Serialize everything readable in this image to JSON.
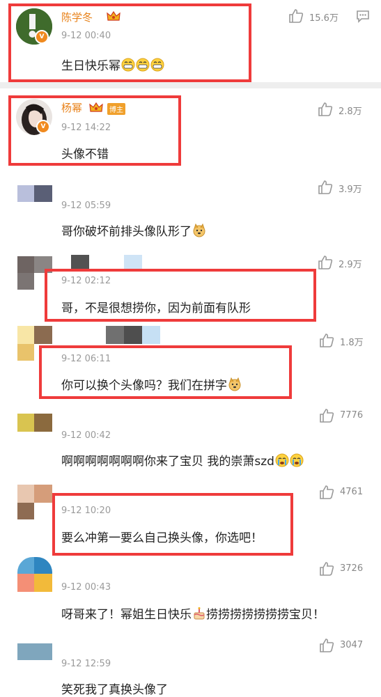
{
  "comments": [
    {
      "name": "陈学冬",
      "time": "9-12 00:40",
      "text": "生日快乐幂",
      "emojis": [
        "grin-emoji",
        "grin-emoji",
        "grin-emoji"
      ],
      "likes": "15.6万"
    },
    {
      "name": "杨幂",
      "badge": "博主",
      "time": "9-12 14:22",
      "text": "头像不错",
      "likes": "2.8万"
    },
    {
      "time": "9-12 05:59",
      "text": "哥你破坏前排头像队形了",
      "emojis": [
        "doge-emoji"
      ],
      "likes": "3.9万"
    },
    {
      "time": "9-12 02:12",
      "text": "哥，不是很想捞你，因为前面有队形",
      "likes": "2.9万"
    },
    {
      "time": "9-12 06:11",
      "text": "你可以换个头像吗？我们在拼字",
      "emojis": [
        "doge-emoji"
      ],
      "likes": "1.8万"
    },
    {
      "time": "9-12 00:42",
      "text": "啊啊啊啊啊啊啊你来了宝贝 我的崇萧szd",
      "emojis": [
        "crying-emoji",
        "crying-emoji"
      ],
      "likes": "7776"
    },
    {
      "time": "9-12 10:20",
      "text": "要么冲第一要么自己换头像，你选吧！",
      "likes": "4761"
    },
    {
      "time": "9-12 00:43",
      "text_a": "呀哥来了！幂姐生日快乐",
      "text_b": "捞捞捞捞捞捞捞宝贝！",
      "emojis": [
        "cake-emoji"
      ],
      "likes": "3726"
    },
    {
      "time": "9-12 12:59",
      "text": "笑死我了真换头像了",
      "likes": "3047"
    }
  ],
  "colors": {
    "accent": "#e8821a",
    "highlight": "#ef3b3b",
    "time": "#9a9a9a"
  }
}
